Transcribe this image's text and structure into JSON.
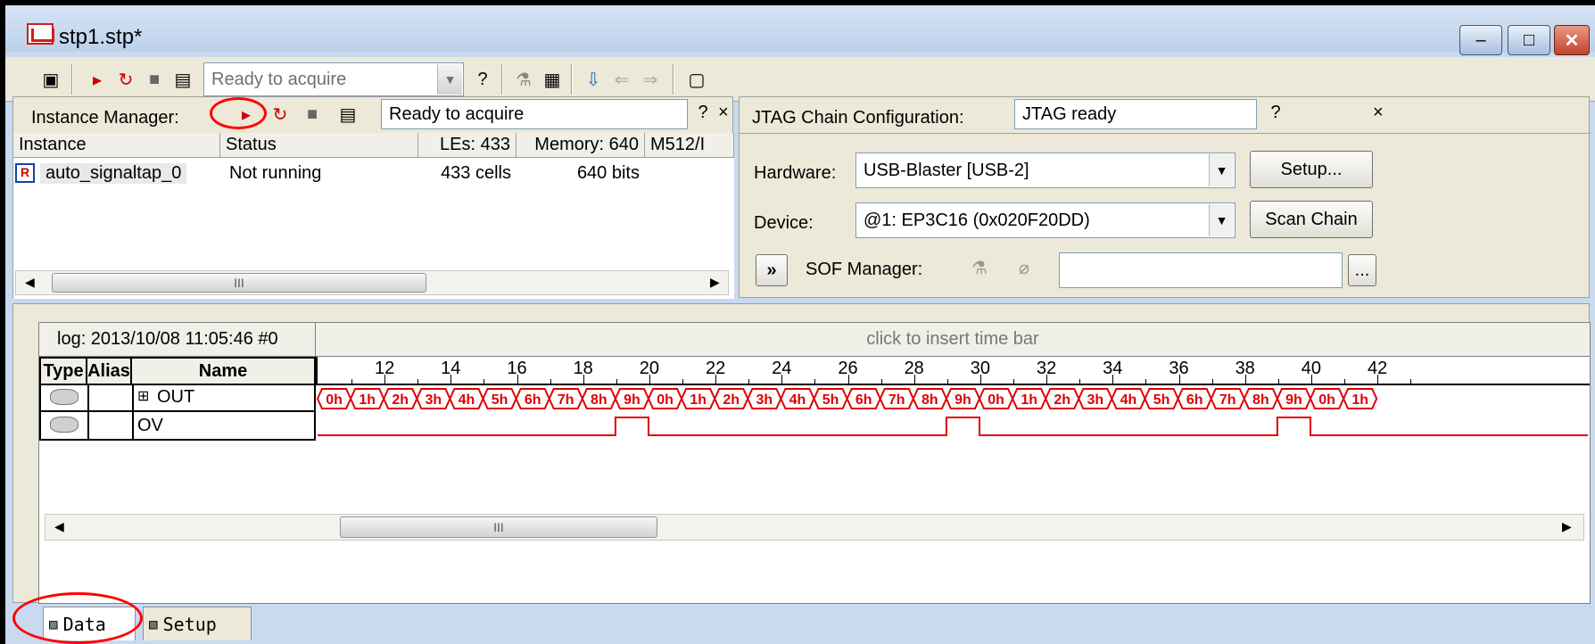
{
  "window": {
    "title": "stp1.stp*",
    "controls": {
      "minimize": "–",
      "maximize": "□",
      "close": "✕"
    }
  },
  "main_toolbar": {
    "status_combo": "Ready to acquire"
  },
  "instance_manager": {
    "label": "Instance Manager:",
    "status": "Ready to acquire",
    "close": "×",
    "columns": [
      "Instance",
      "Status",
      "LEs: 433",
      "Memory: 640",
      "M512/I"
    ],
    "rows": [
      {
        "instance": "auto_signaltap_0",
        "status": "Not running",
        "les": "433 cells",
        "memory": "640 bits"
      }
    ],
    "scroll_thumb": "III"
  },
  "jtag": {
    "label": "JTAG Chain Configuration:",
    "status": "JTAG ready",
    "close": "×",
    "hardware_label": "Hardware:",
    "hardware_value": "USB-Blaster [USB-2]",
    "setup_button": "Setup...",
    "device_label": "Device:",
    "device_value": "@1: EP3C16 (0x020F20DD)",
    "scan_button": "Scan Chain",
    "expand_button": "»",
    "sof_label": "SOF Manager:",
    "browse_button": "..."
  },
  "waveform": {
    "log_label": "log: 2013/10/08 11:05:46  #0",
    "insert_hint": "click to insert time bar",
    "headers": {
      "type": "Type",
      "alias": "Alias",
      "name": "Name"
    },
    "ticks": [
      "12",
      "14",
      "16",
      "18",
      "20",
      "22",
      "24",
      "26",
      "28",
      "30",
      "32",
      "34",
      "36",
      "38",
      "40",
      "42"
    ],
    "signals": [
      {
        "name": "OUT",
        "expand": "⊞"
      },
      {
        "name": "OV"
      }
    ],
    "out_values": [
      "0h",
      "1h",
      "2h",
      "3h",
      "4h",
      "5h",
      "6h",
      "7h",
      "8h",
      "9h",
      "0h",
      "1h",
      "2h",
      "3h",
      "4h",
      "5h",
      "6h",
      "7h",
      "8h",
      "9h",
      "0h",
      "1h",
      "2h",
      "3h",
      "4h",
      "5h",
      "6h",
      "7h",
      "8h",
      "9h",
      "0h",
      "1h"
    ],
    "ov_pulses": [
      {
        "start": 20,
        "end": 21
      },
      {
        "start": 30,
        "end": 31
      },
      {
        "start": 40,
        "end": 41
      }
    ],
    "scroll_thumb": "III",
    "wave_color": "#e00000"
  },
  "tabs": [
    {
      "label": "Data",
      "icon": "data-icon"
    },
    {
      "label": "Setup",
      "icon": "setup-icon"
    }
  ]
}
